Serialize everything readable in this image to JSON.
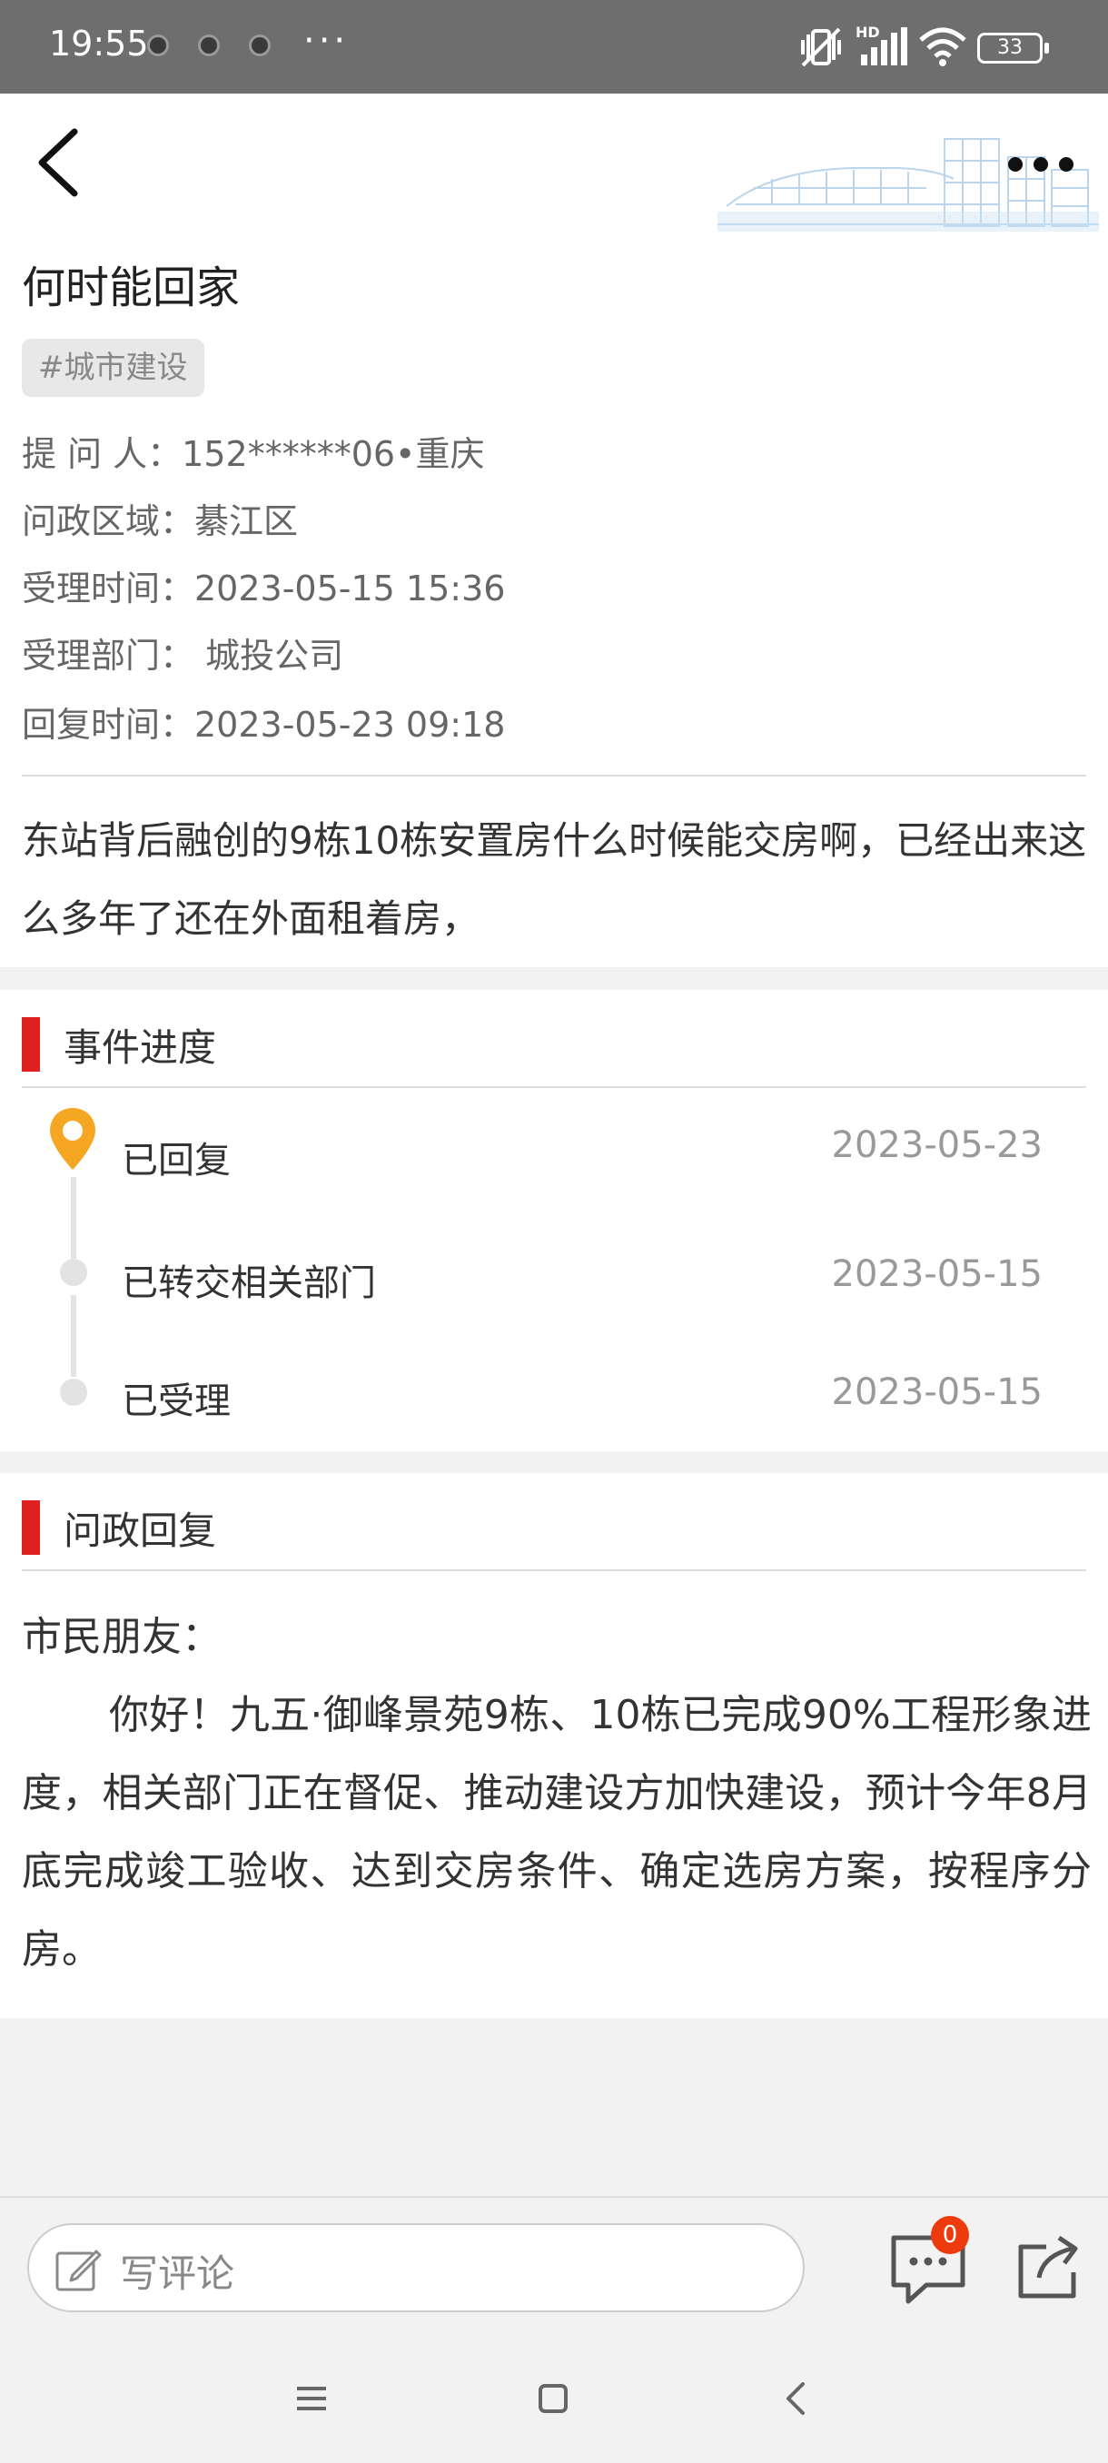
{
  "status_bar": {
    "time": "19:55",
    "more": "···",
    "battery": "33",
    "network": "HD"
  },
  "header": {
    "back_icon": "chevron-left-icon",
    "more_icon": "more-dots-icon"
  },
  "article": {
    "title": "何时能回家",
    "tag": "#城市建设",
    "meta": {
      "asker": "提  问 人：152******06•重庆",
      "region": "问政区域：綦江区",
      "accept_time": "受理时间：2023-05-15 15:36",
      "department": "受理部门： 城投公司",
      "reply_time": "回复时间：2023-05-23 09:18"
    },
    "question": "东站背后融创的9栋10栋安置房什么时候能交房啊，已经出来这么多年了还在外面租着房，"
  },
  "progress": {
    "heading": "事件进度",
    "items": [
      {
        "label": "已回复",
        "date": "2023-05-23"
      },
      {
        "label": "已转交相关部门",
        "date": "2023-05-15"
      },
      {
        "label": "已受理",
        "date": "2023-05-15"
      }
    ]
  },
  "reply": {
    "heading": "问政回复",
    "greeting": "市民朋友：",
    "body": "你好！九五·御峰景苑9栋、10栋已完成90%工程形象进度，相关部门正在督促、推动建设方加快建设，预计今年8月底完成竣工验收、达到交房条件、确定选房方案，按程序分房。"
  },
  "bottom_bar": {
    "comment_placeholder": "写评论",
    "comment_count": "0"
  },
  "colors": {
    "accent_red": "#e02020",
    "pin_yellow": "#f5a623",
    "badge": "#ee3b0e"
  }
}
